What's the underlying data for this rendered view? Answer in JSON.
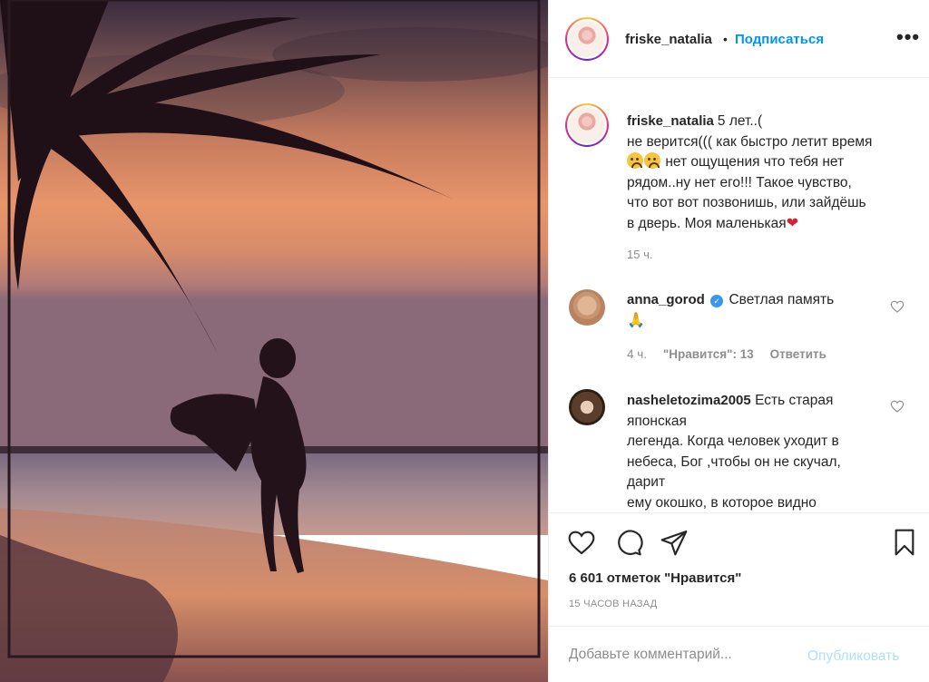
{
  "header": {
    "username": "friske_natalia",
    "separator": "•",
    "follow_label": "Подписаться",
    "more_label": "•••"
  },
  "caption": {
    "username": "friske_natalia",
    "line1": "5 лет..(",
    "line2": "не верится((( как быстро летит время",
    "line3": "нет ощущения что тебя нет",
    "line4": "рядом..ну нет его!!! Такое чувство,",
    "line5": "что вот вот позвонишь, или зайдёшь",
    "line6": "в дверь. Моя маленькая",
    "heart": "❤",
    "time": "15 ч."
  },
  "comments": [
    {
      "username": "anna_gorod",
      "verified_mark": "✓",
      "text": "Светлая память",
      "emoji": "🙏",
      "time": "4 ч.",
      "likes": "\"Нравится\": 13",
      "reply": "Ответить"
    },
    {
      "username": "nasheletozima2005",
      "text_line1": "Есть старая",
      "text_line2": "японская",
      "text_line3": "легенда. Когда человек уходит в",
      "text_line4": "небеса, Бог ,чтобы он не скучал,",
      "text_line5": "дарит",
      "text_line6": "ему окошко, в которое видно"
    }
  ],
  "actions": {
    "likes_count": "6 601 отметок \"Нравится\"",
    "posted": "15 ЧАСОВ НАЗАД"
  },
  "add_comment": {
    "placeholder": "Добавьте комментарий...",
    "publish_label": "Опубликовать"
  },
  "colors": {
    "accent": "#0095f6",
    "publish_disabled": "#b2dffc",
    "muted": "#8e8e8e",
    "text": "#262626"
  }
}
